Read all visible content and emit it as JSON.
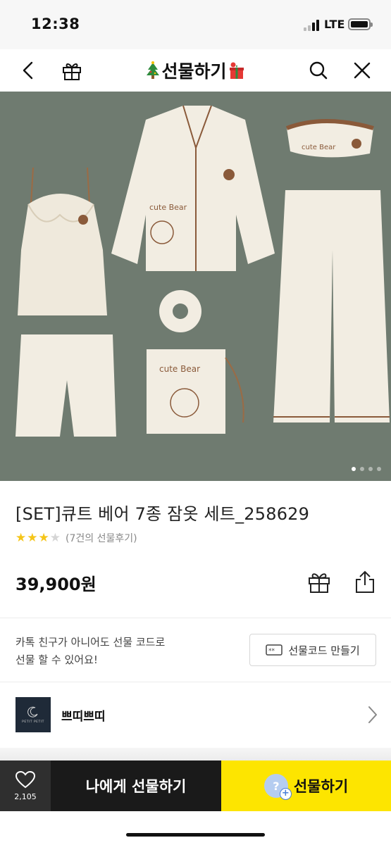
{
  "status_bar": {
    "time": "12:38",
    "network": "LTE"
  },
  "nav": {
    "back_icon": "chevron-left-icon",
    "gift_box_icon": "gift-box-icon",
    "title": "선물하기",
    "search_icon": "search-icon",
    "close_icon": "close-icon"
  },
  "hero": {
    "image_label": "cute Bear",
    "background_color": "#6f7b70",
    "page_count": 4,
    "active_page": 1
  },
  "product": {
    "title": "[SET]큐트 베어 7종 잠옷 세트_258629",
    "rating": 3,
    "rating_max": 5,
    "review_text": "(7건의 선물후기)",
    "price": "39,900원"
  },
  "gift_code": {
    "line1": "카톡 친구가 아니어도 선물 코드로",
    "line2": "선물 할 수 있어요!",
    "button_label": "선물코드 만들기"
  },
  "brand": {
    "name": "쁘띠쁘띠",
    "logo_text": "PETIT PETIT"
  },
  "bottom_bar": {
    "like_count": "2,105",
    "self_gift_label": "나에게 선물하기",
    "gift_label": "선물하기",
    "gift_badge": "?",
    "accent_color": "#fde500"
  }
}
